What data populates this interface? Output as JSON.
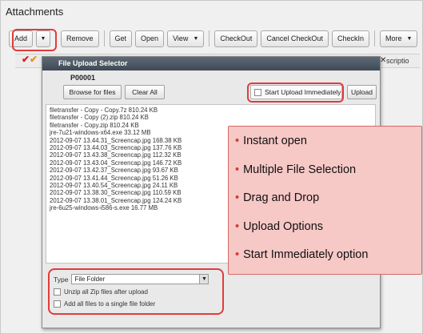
{
  "panel": {
    "title": "Attachments"
  },
  "toolbar": {
    "add": "Add",
    "remove": "Remove",
    "get": "Get",
    "open": "Open",
    "view": "View",
    "checkout": "CheckOut",
    "cancel_checkout": "Cancel CheckOut",
    "checkin": "CheckIn",
    "more": "More",
    "dropdown_glyph": "▼"
  },
  "grid": {
    "description_header": "scriptio",
    "close_glyph": "✕",
    "check_red": "✔",
    "check_orange": "✔"
  },
  "dialog": {
    "title": "File Upload Selector",
    "subtitle": "P00001",
    "browse_button": "Browse for files",
    "clear_button": "Clear All",
    "start_immediately": "Start Upload Immediately",
    "upload_button": "Upload",
    "files": [
      "filetransfer - Copy - Copy.7z 810.24 KB",
      "filetransfer - Copy (2).zip 810.24 KB",
      "filetransfer - Copy.zip 810.24 KB",
      "jre-7u21-windows-x64.exe 33.12 MB",
      "2012-09-07 13.44.31_Screencap.jpg 168.38 KB",
      "2012-09-07 13.44.03_Screencap.jpg 137.76 KB",
      "2012-09-07 13.43.38_Screencap.jpg 112.32 KB",
      "2012-09-07 13.43.04_Screencap.jpg 146.72 KB",
      "2012-09-07 13.42.37_Screencap.jpg 93.67 KB",
      "2012-09-07 13.41.44_Screencap.jpg 51.26 KB",
      "2012-09-07 13.40.54_Screencap.jpg 24.11 KB",
      "2012-09-07 13.38.30_Screencap.jpg 110.59 KB",
      "2012-09-07 13.38.01_Screencap.jpg 124.24 KB",
      "jre-6u25-windows-i586-s.exe 16.77 MB"
    ],
    "type_label": "Type",
    "type_value": "File Folder",
    "unzip_option": "Unzip all Zip files after upload",
    "single_folder_option": "Add all files to a single file folder"
  },
  "callout": {
    "items": [
      "Instant open",
      "Multiple File Selection",
      "Drag and Drop",
      "Upload Options",
      "Start Immediately option"
    ]
  },
  "colors": {
    "highlight": "#e23b3b",
    "callout_bg": "#f6c8c6",
    "titlebar": "#4a5561"
  }
}
